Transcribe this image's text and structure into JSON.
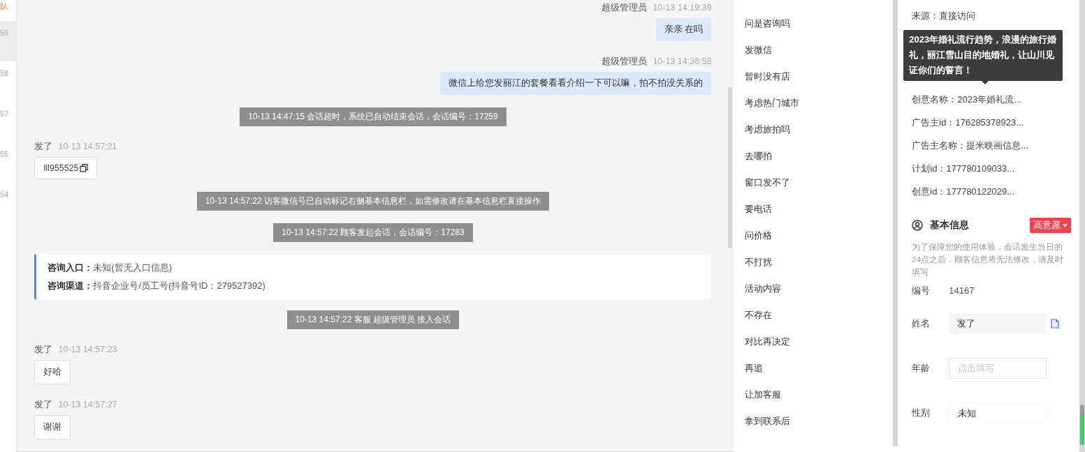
{
  "session_list": {
    "header": "队",
    "items": [
      {
        "label": "59",
        "selected": true
      },
      {
        "label": "58",
        "selected": false
      },
      {
        "label": "57",
        "selected": false
      },
      {
        "label": "55",
        "selected": false
      },
      {
        "label": "54",
        "selected": false
      }
    ]
  },
  "chat": {
    "messages": [
      {
        "kind": "agent",
        "sender": "超级管理员",
        "time": "10-13 14:19:39",
        "text": "亲亲 在吗"
      },
      {
        "kind": "agent",
        "sender": "超级管理员",
        "time": "10-13 14:36:58",
        "text": "微信上给您发丽江的套餐看看介绍一下可以嘛，拍不拍没关系的"
      },
      {
        "kind": "system",
        "text": "10-13 14:47:15 会话超时，系统已自动结束会话，会话编号：17259"
      },
      {
        "kind": "customer",
        "sender": "发了",
        "time": "10-13 14:57:21",
        "text": "lll955525",
        "copy": true
      },
      {
        "kind": "system",
        "text": "10-13 14:57:22 访客微信号已自动标记右侧基本信息栏，如需修改请在基本信息栏直接操作"
      },
      {
        "kind": "system",
        "text": "10-13 14:57:22 顾客发起会话，会话编号：17283"
      },
      {
        "kind": "entry",
        "lines": [
          {
            "label": "咨询入口：",
            "value": "未知(暂无入口信息)"
          },
          {
            "label": "咨询渠道：",
            "value": "抖音企业号/员工号(抖音号ID：279527392)"
          }
        ]
      },
      {
        "kind": "system",
        "text": "10-13 14:57:22 客服 超级管理员 接入会话"
      },
      {
        "kind": "customer",
        "sender": "发了",
        "time": "10-13 14:57:23",
        "text": "好哈",
        "copy": false
      },
      {
        "kind": "customer",
        "sender": "发了",
        "time": "10-13 14:57:27",
        "text": "谢谢",
        "copy": false
      }
    ]
  },
  "quick_replies": [
    "问是咨询吗",
    "发微信",
    "暂时没有店",
    "考虑热门城市",
    "考虑旅拍吗",
    "去哪拍",
    "窗口发不了",
    "要电话",
    "问价格",
    "不打扰",
    "活动内容",
    "不存在",
    "对比再决定",
    "再追",
    "让加客服",
    "拿到联系后"
  ],
  "source_info": [
    "来源：直接访问",
    "创意名称：2023年婚礼流...",
    "广告主id：176285378923...",
    "广告主名称：提米映画信息...",
    "计划id：177780109033...",
    "创意id：177780122029..."
  ],
  "tooltip": "2023年婚礼流行趋势，浪漫的旅行婚礼，丽江雪山目的地婚礼，让山川见证你们的誓言！",
  "basic_info": {
    "title": "基本信息",
    "intent_tag": "高意愿",
    "note": "为了保障您的使用体验，会话发生当日的24点之后，顾客信息将无法修改，请及时填写",
    "fields": [
      {
        "kind": "text",
        "label": "编号",
        "value": "14167"
      },
      {
        "kind": "readonly",
        "label": "姓名",
        "value": "发了"
      },
      {
        "kind": "input",
        "label": "年龄",
        "placeholder": "点击填写"
      },
      {
        "kind": "select",
        "label": "性别",
        "value": "未知"
      }
    ]
  }
}
